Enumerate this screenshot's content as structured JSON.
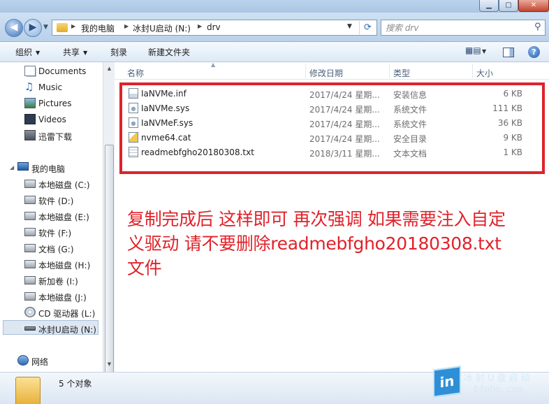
{
  "address_bar": {
    "crumbs": [
      "我的电脑",
      "冰封U启动 (N:)",
      "drv"
    ]
  },
  "search": {
    "placeholder": "搜索 drv"
  },
  "toolbar": {
    "organize": "组织",
    "share": "共享",
    "burn": "刻录",
    "new_folder": "新建文件夹"
  },
  "sidebar": {
    "libraries": [
      {
        "label": "Documents",
        "icon": "documents-icon"
      },
      {
        "label": "Music",
        "icon": "music-icon"
      },
      {
        "label": "Pictures",
        "icon": "pictures-icon"
      },
      {
        "label": "Videos",
        "icon": "videos-icon"
      },
      {
        "label": "迅雷下载",
        "icon": "download-icon"
      }
    ],
    "computer": "我的电脑",
    "drives": [
      {
        "label": "本地磁盘 (C:)",
        "icon": "system-drive-icon"
      },
      {
        "label": "软件 (D:)",
        "icon": "drive-icon"
      },
      {
        "label": "本地磁盘 (E:)",
        "icon": "drive-icon"
      },
      {
        "label": "软件 (F:)",
        "icon": "drive-icon"
      },
      {
        "label": "文档 (G:)",
        "icon": "drive-icon"
      },
      {
        "label": "本地磁盘 (H:)",
        "icon": "drive-icon"
      },
      {
        "label": "新加卷 (I:)",
        "icon": "drive-icon"
      },
      {
        "label": "本地磁盘 (J:)",
        "icon": "drive-icon"
      },
      {
        "label": "CD 驱动器 (L:)",
        "icon": "cd-drive-icon"
      },
      {
        "label": "冰封U启动 (N:)",
        "icon": "usb-drive-icon",
        "selected": true
      }
    ],
    "network": "网络"
  },
  "columns": {
    "name": "名称",
    "date": "修改日期",
    "type": "类型",
    "size": "大小"
  },
  "files": [
    {
      "name": "IaNVMe.inf",
      "date": "2017/4/24 星期...",
      "type": "安装信息",
      "size": "6 KB",
      "icon": "setup-info-icon"
    },
    {
      "name": "IaNVMe.sys",
      "date": "2017/4/24 星期...",
      "type": "系统文件",
      "size": "111 KB",
      "icon": "system-file-icon"
    },
    {
      "name": "IaNVMeF.sys",
      "date": "2017/4/24 星期...",
      "type": "系统文件",
      "size": "36 KB",
      "icon": "system-file-icon"
    },
    {
      "name": "nvme64.cat",
      "date": "2017/4/24 星期...",
      "type": "安全目录",
      "size": "9 KB",
      "icon": "security-catalog-icon"
    },
    {
      "name": "readmebfgho20180308.txt",
      "date": "2018/3/11 星期...",
      "type": "文本文档",
      "size": "1 KB",
      "icon": "text-file-icon"
    }
  ],
  "annotation": {
    "line1": "复制完成后 这样即可 再次强调 如果需要注入自定",
    "line2": "义驱动 请不要删除readmebfgho20180308.txt",
    "line3": "文件",
    "color": "#e0222a"
  },
  "status": {
    "count": "5 个对象"
  },
  "watermark": {
    "logo": "in",
    "line1": "冰封U盘启动",
    "line2": "bfgho.com"
  }
}
